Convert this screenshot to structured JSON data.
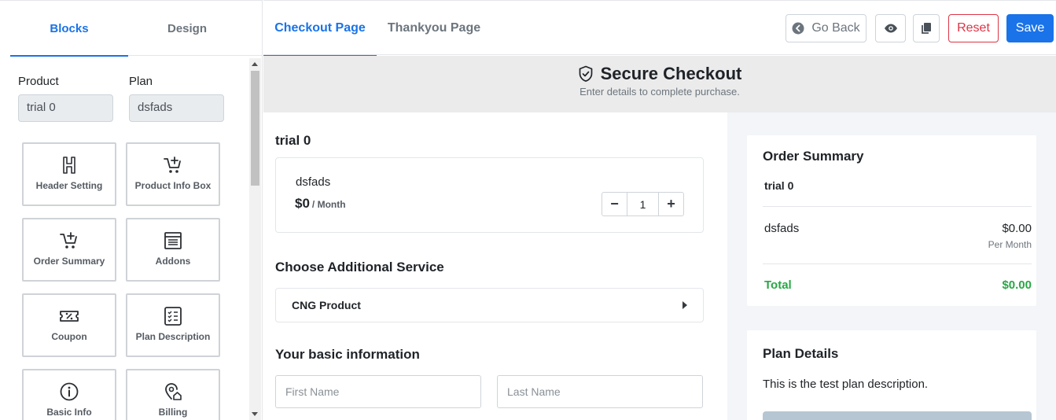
{
  "sidebar": {
    "tabs": [
      {
        "label": "Blocks",
        "active": true
      },
      {
        "label": "Design",
        "active": false
      }
    ],
    "product_label": "Product",
    "product_value": "trial 0",
    "plan_label": "Plan",
    "plan_value": "dsfads",
    "blocks": [
      {
        "label": "Header Setting",
        "icon": "header-icon"
      },
      {
        "label": "Product Info Box",
        "icon": "cart-plus-icon"
      },
      {
        "label": "Order Summary",
        "icon": "cart-plus-icon"
      },
      {
        "label": "Addons",
        "icon": "addons-icon"
      },
      {
        "label": "Coupon",
        "icon": "coupon-icon"
      },
      {
        "label": "Plan Description",
        "icon": "checklist-icon"
      },
      {
        "label": "Basic Info",
        "icon": "info-icon"
      },
      {
        "label": "Billing",
        "icon": "billing-icon"
      }
    ]
  },
  "toolbar": {
    "page_tabs": [
      {
        "label": "Checkout Page",
        "active": true
      },
      {
        "label": "Thankyou Page",
        "active": false
      }
    ],
    "go_back_label": "Go Back",
    "reset_label": "Reset",
    "save_label": "Save"
  },
  "banner": {
    "title": "Secure Checkout",
    "subtitle": "Enter details to complete purchase."
  },
  "main": {
    "product_title": "trial 0",
    "plan_name": "dsfads",
    "price": "$0",
    "price_period": "/ Month",
    "quantity": "1",
    "addons_title": "Choose Additional Service",
    "addon_item": "CNG Product",
    "basic_info_title": "Your basic information",
    "first_name_placeholder": "First Name",
    "last_name_placeholder": "Last Name"
  },
  "summary": {
    "title": "Order Summary",
    "product": "trial 0",
    "plan": "dsfads",
    "amount": "$0.00",
    "period": "Per Month",
    "total_label": "Total",
    "total_value": "$0.00"
  },
  "plan_details": {
    "title": "Plan Details",
    "description": "This is the test plan description."
  },
  "colors": {
    "accent": "#1a73e8",
    "danger": "#dc3545",
    "success": "#28a745",
    "banner_bg": "#ebebeb"
  }
}
